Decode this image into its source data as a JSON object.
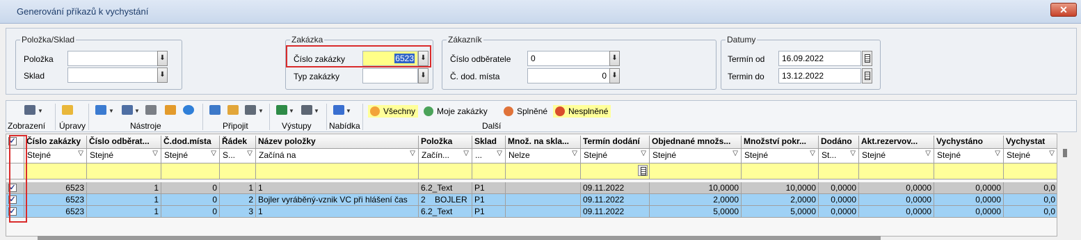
{
  "window": {
    "title": "Generování příkazů k vychystání",
    "close_glyph": "✕"
  },
  "filters": {
    "polozka_sklad": {
      "legend": "Položka/Sklad",
      "polozka_label": "Položka",
      "polozka_value": "",
      "sklad_label": "Sklad",
      "sklad_value": ""
    },
    "zakazka": {
      "legend": "Zakázka",
      "cislo_label": "Číslo zakázky",
      "cislo_value": "6523",
      "typ_label": "Typ zakázky",
      "typ_value": ""
    },
    "zakaznik": {
      "legend": "Zákazník",
      "odberatel_label": "Číslo odběratele",
      "odberatel_value": "0",
      "dod_mista_label": "Č. dod. místa",
      "dod_mista_value": "0"
    },
    "datumy": {
      "legend": "Datumy",
      "od_label": "Termín od",
      "od_value": "16.09.2022",
      "do_label": "Termin do",
      "do_value": "13.12.2022"
    }
  },
  "toolbar": {
    "zobrazeni": "Zobrazení",
    "upravy": "Úpravy",
    "nastroje": "Nástroje",
    "pripojit": "Připojit",
    "vystupy": "Výstupy",
    "nabidka": "Nabídka",
    "dalsi": "Další",
    "vsechny": "Všechny",
    "moje_zakazky": "Moje zakázky",
    "splnene": "Splněné",
    "nesplnene": "Nesplněné"
  },
  "grid": {
    "columns": [
      "Číslo zakázky",
      "Číslo odběrat...",
      "Č.dod.místa",
      "Řádek",
      "Název položky",
      "Položka",
      "Sklad",
      "Množ. na skla...",
      "Termín dodání",
      "Objednané množs...",
      "Množství pokr...",
      "Dodáno",
      "Akt.rezervov...",
      "Vychystáno",
      "Vychystat"
    ],
    "filters": [
      "Stejné",
      "Stejné",
      "Stejné",
      "S...",
      "Začíná na",
      "Začín...",
      "...",
      "Nelze",
      "Stejné",
      "Stejné",
      "Stejné",
      "St...",
      "Stejné",
      "Stejné",
      "Stejné"
    ],
    "rows": [
      [
        "6523",
        "1",
        "0",
        "1",
        "1",
        "6.2_Text",
        "P1",
        "",
        "09.11.2022",
        "10,0000",
        "10,0000",
        "0,0000",
        "0,0000",
        "0,0000",
        "0,0"
      ],
      [
        "6523",
        "1",
        "0",
        "2",
        "Bojler vyráběný-vznik VC při hlášení čas",
        "2    BOJLER",
        "P1",
        "",
        "09.11.2022",
        "2,0000",
        "2,0000",
        "0,0000",
        "0,0000",
        "0,0000",
        "0,0"
      ],
      [
        "6523",
        "1",
        "0",
        "3",
        "1",
        "6.2_Text",
        "P1",
        "",
        "09.11.2022",
        "5,0000",
        "5,0000",
        "0,0000",
        "0,0000",
        "0,0000",
        "0,0"
      ]
    ],
    "check_glyph": "✓"
  }
}
